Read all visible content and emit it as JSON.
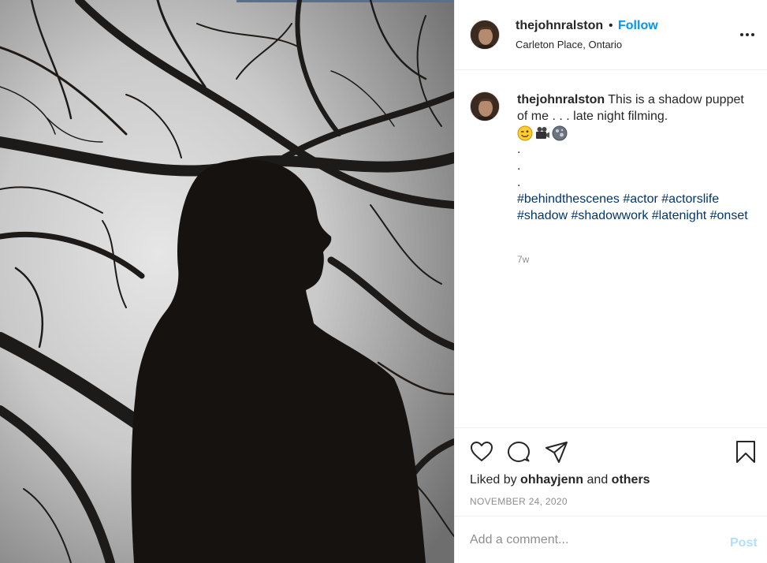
{
  "post": {
    "image_alt": "Silhouette of a person against bare tree branches",
    "username": "thejohnralston",
    "separator": "•",
    "follow_label": "Follow",
    "location": "Carleton Place, Ontario",
    "more_icon": "more-horizontal-icon"
  },
  "caption": {
    "username": "thejohnralston",
    "text": "This is a shadow puppet of me . . . late night filming.",
    "emojis": [
      "winking-face-emoji",
      "movie-camera-emoji",
      "full-moon-emoji"
    ],
    "dots": [
      ".",
      ".",
      "."
    ],
    "hashtags": [
      "#behindthescenes",
      "#actor",
      "#actorslife",
      "#shadow",
      "#shadowwork",
      "#latenight",
      "#onset"
    ],
    "time_ago": "7w"
  },
  "actions": {
    "icons": [
      "heart-icon",
      "comment-icon",
      "share-icon",
      "bookmark-icon"
    ],
    "liked_prefix": "Liked by",
    "liked_user": "ohhayjenn",
    "liked_and": "and",
    "liked_others": "others",
    "date": "NOVEMBER 24, 2020"
  },
  "comment": {
    "placeholder": "Add a comment...",
    "post_label": "Post"
  },
  "colors": {
    "link_blue": "#0095f6",
    "hashtag_blue": "#00376b",
    "post_disabled": "#b2dffc",
    "muted": "#8e8e8e",
    "divider": "#efefef"
  }
}
